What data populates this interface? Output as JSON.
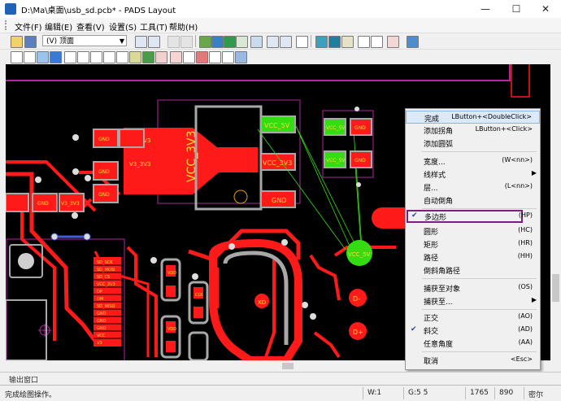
{
  "window": {
    "title": "D:\\Ma\\桌面\\usb_sd.pcb* - PADS Layout",
    "minimize": "—",
    "maximize": "☐",
    "close": "✕"
  },
  "menubar": {
    "items": [
      "文件(F)",
      "编辑(E)",
      "查看(V)",
      "设置(S)",
      "工具(T)",
      "帮助(H)"
    ]
  },
  "toolbar": {
    "layer_select": "(V) 顶面"
  },
  "pcb": {
    "parts": {
      "u_reg_value": "VCC_3V3",
      "u_reg_pin_top": "VCC_3V3",
      "u_reg_pin_mid": "VCC_3V3",
      "u_reg_pin_gnd": "GND",
      "vcc5v_pad": "VCC_5V",
      "test_point": "VCC_5V",
      "c1_gnd": "GND",
      "c1_v": "V3_3V3",
      "c2_gnd": "GND",
      "c2_v": "V3_3V3",
      "c3_gnd": "GND",
      "c3_v": "V3_3V3",
      "c4_gnd": "GND",
      "c4_v": "V3_3V3",
      "c5_gnd": "GND",
      "c5_v": "VCC_5V",
      "c6_gnd": "GND",
      "c6_v": "VCC_5V",
      "usb_d": "XD",
      "usb_dminus": "D-",
      "usb_dplus": "D+",
      "chip_pins": [
        "SD_SCK",
        "SD_MOSI",
        "SD_CS",
        "VCC_3V3",
        "DP",
        "DM",
        "SD_MISO",
        "GND",
        "GND",
        "GND",
        "VCC",
        "V3"
      ],
      "small_nets": [
        "VDD",
        "VDD",
        "VDD",
        "CLK",
        "CLK",
        "GND"
      ]
    }
  },
  "context_menu": {
    "items": [
      {
        "label": "完成",
        "shortcut": "LButton+<DoubleClick>"
      },
      {
        "label": "添加拐角",
        "shortcut": "LButton+<Click>"
      },
      {
        "label": "添加圆弧",
        "shortcut": ""
      },
      {
        "label": "宽度...",
        "shortcut": "(W<nn>)"
      },
      {
        "label": "线样式",
        "shortcut": ""
      },
      {
        "label": "层...",
        "shortcut": "(L<nn>)"
      },
      {
        "label": "自动倒角",
        "shortcut": ""
      },
      {
        "label": "多边形",
        "shortcut": "(HP)"
      },
      {
        "label": "圆形",
        "shortcut": "(HC)"
      },
      {
        "label": "矩形",
        "shortcut": "(HR)"
      },
      {
        "label": "路径",
        "shortcut": "(HH)"
      },
      {
        "label": "倒斜角路径",
        "shortcut": ""
      },
      {
        "label": "捕获至对象",
        "shortcut": "(OS)"
      },
      {
        "label": "捕获至...",
        "shortcut": ""
      },
      {
        "label": "正交",
        "shortcut": "(AO)"
      },
      {
        "label": "斜交",
        "shortcut": "(AD)"
      },
      {
        "label": "任意角度",
        "shortcut": "(AA)"
      },
      {
        "label": "取消",
        "shortcut": "<Esc>"
      }
    ],
    "check": "✔",
    "submenu_arrow": "▶"
  },
  "output_window": {
    "tab": "输出窗口"
  },
  "statusbar": {
    "message": "完成绘图操作。",
    "width": "W:1",
    "grid": "G:5 5",
    "x": "1765",
    "y": "890",
    "unit": "密尔"
  },
  "colors": {
    "canvas": "#000000",
    "copper": "#ff1a1a",
    "pad_gray": "#a8a8a8",
    "pad_green": "#33dd11",
    "outline_magenta": "#b0279f",
    "via_blue": "#3f5fd8",
    "selection_box": "#7a1f7a"
  }
}
